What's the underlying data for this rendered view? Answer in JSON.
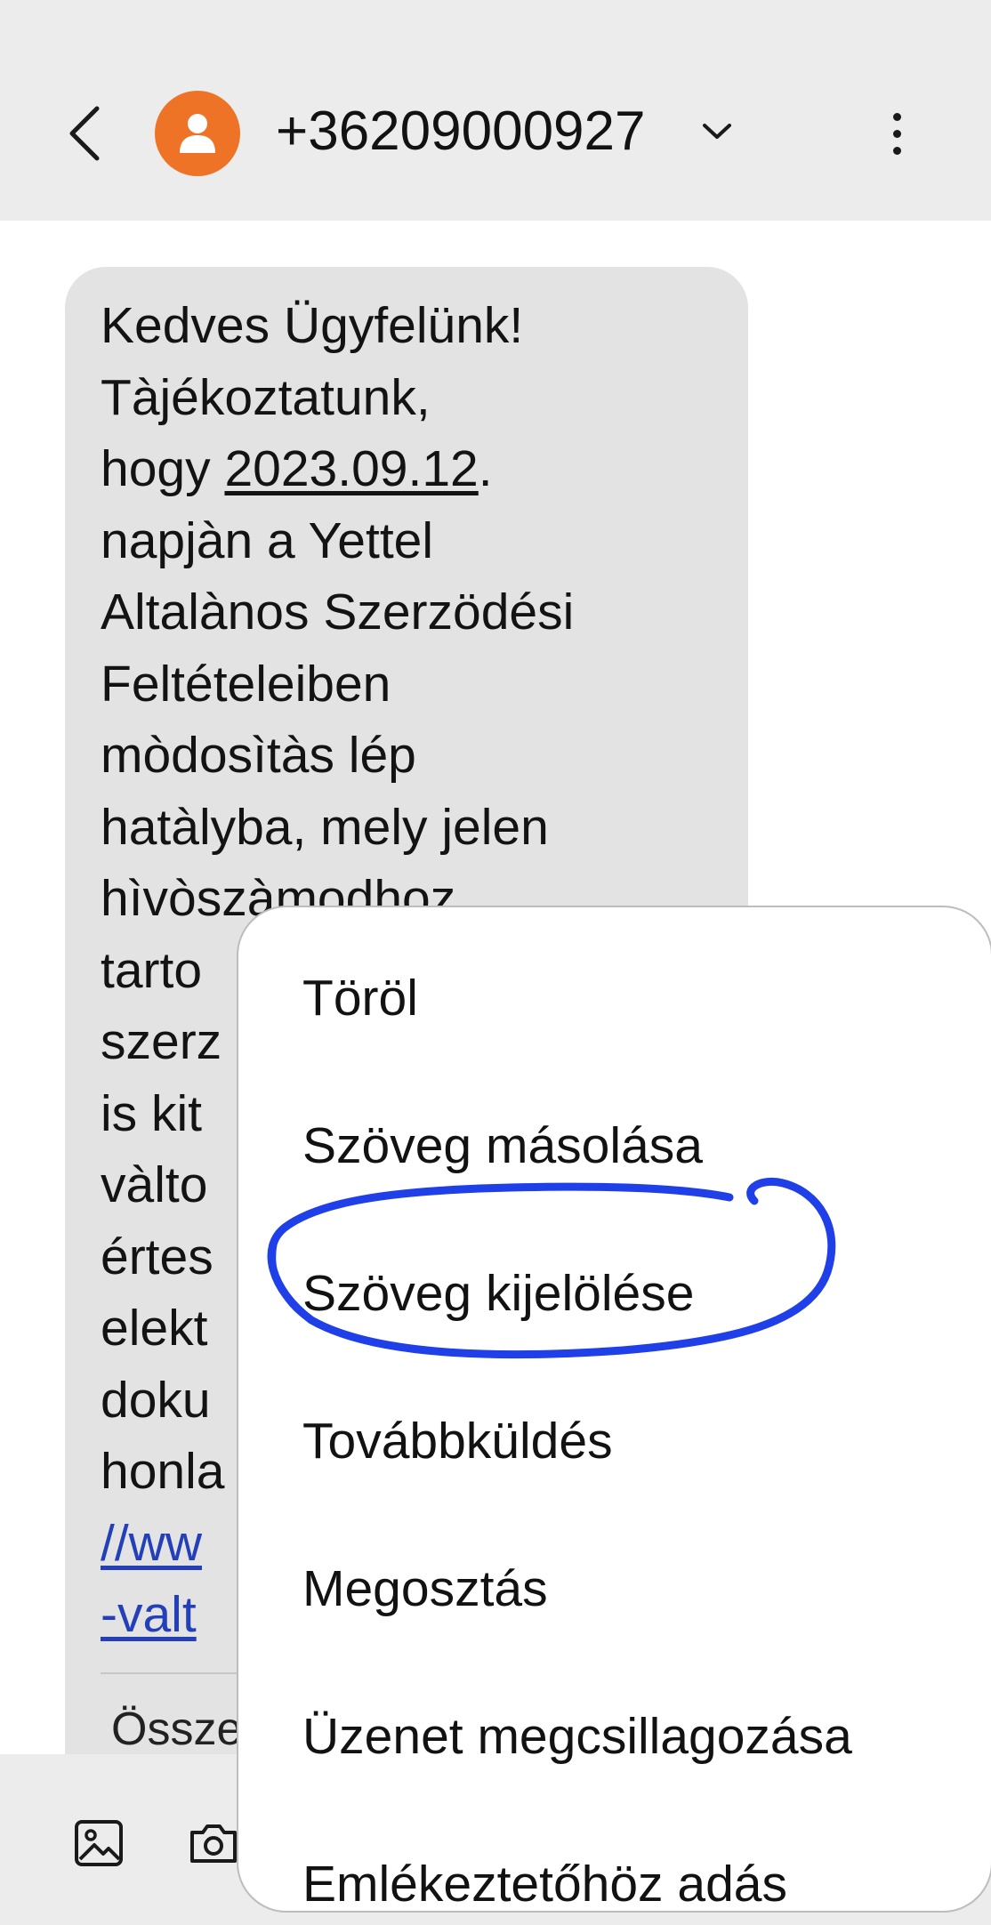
{
  "header": {
    "phone_number": "+36209000927",
    "icons": {
      "back": "back-arrow-icon",
      "avatar": "person-icon",
      "expand": "chevron-down-icon",
      "more": "more-vert-icon"
    }
  },
  "message": {
    "intro": "Kedves Ügyfelünk!\nTàjékoztatunk,\nhogy ",
    "date": "2023.09.12",
    "body": ".\nnapjàn a Yettel\nAltalànos Szerzödési\nFeltételeiben\nmòdosìtàs lép\nhatàlyba, mely jelen\nhìvòszàmodhoz\ntarto\nszerz\nis kit\nvàlto\nértes\nelekt\ndoku\nhonla",
    "link_line1": "//ww",
    "link_line2": "-valt",
    "footer_text": "Össze"
  },
  "context_menu": {
    "items": [
      "Töröl",
      "Szöveg másolása",
      "Szöveg kijelölése",
      "Továbbküldés",
      "Megosztás",
      "Üzenet megcsillagozása",
      "Emlékeztetőhöz adás"
    ],
    "highlighted_item": "Szöveg kijelölése",
    "highlight_color": "#1f3fe8"
  },
  "bottom_bar": {
    "icons": [
      "image-icon",
      "camera-icon"
    ]
  },
  "colors": {
    "avatar": "#ee7326",
    "header_bg": "#ececec",
    "bubble_bg": "#e3e3e3",
    "link": "#2440b8"
  }
}
